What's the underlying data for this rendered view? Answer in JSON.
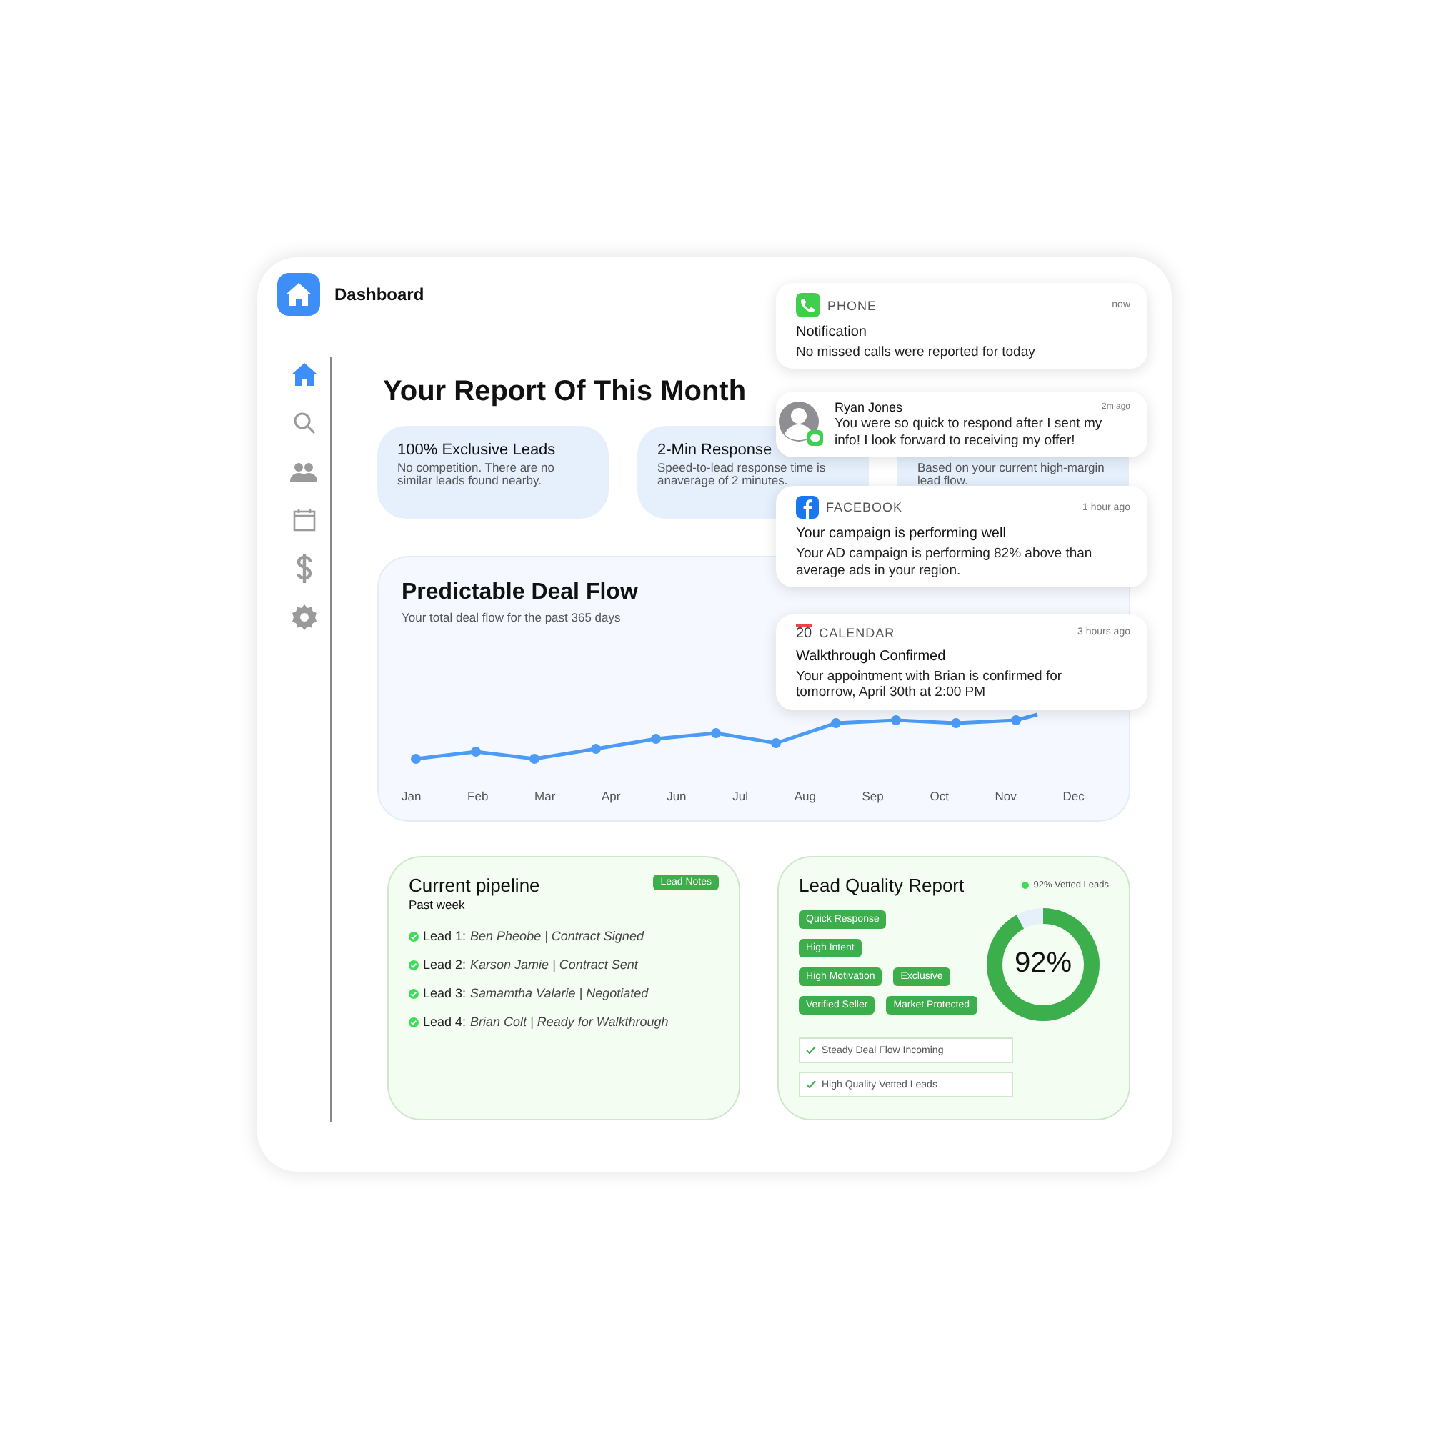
{
  "header": {
    "title": "Dashboard"
  },
  "sidebar": {
    "items": [
      {
        "selected": true
      },
      {
        "selected": false
      },
      {
        "selected": false
      },
      {
        "selected": false
      },
      {
        "selected": false
      },
      {
        "selected": false
      }
    ]
  },
  "report": {
    "title": "Your Report Of This Month",
    "stats": [
      {
        "title": "100% Exclusive Leads",
        "text": "No competition. There are no similar leads found nearby."
      },
      {
        "title": "2-Min Response",
        "text": "Speed-to-lead response time is anaverage of 2 minutes."
      },
      {
        "text": "Based on your current high-margin lead flow."
      }
    ]
  },
  "deal_flow": {
    "title": "Predictable Deal Flow",
    "subtitle": "Your total deal flow for the past 365 days",
    "months": [
      "Jan",
      "Feb",
      "Mar",
      "Apr",
      "Jun",
      "Jul",
      "Aug",
      "Sep",
      "Oct",
      "Nov",
      "Dec"
    ]
  },
  "pipeline": {
    "title": "Current pipeline",
    "subtitle": "Past week",
    "badge": "Lead Notes",
    "leads": [
      {
        "label": "Lead 1:",
        "detail": "Ben Pheobe | Contract Signed"
      },
      {
        "label": "Lead 2:",
        "detail": "Karson Jamie | Contract Sent"
      },
      {
        "label": "Lead 3:",
        "detail": "Samamtha Valarie | Negotiated"
      },
      {
        "label": "Lead 4:",
        "detail": "Brian Colt | Ready for Walkthrough"
      }
    ]
  },
  "quality": {
    "title": "Lead Quality Report",
    "legend": "92% Vetted Leads",
    "value": "92%",
    "level": 0.92,
    "tag_rows": [
      [
        "Quick Response"
      ],
      [
        "High Intent"
      ],
      [
        "High Motivation",
        "Exclusive"
      ],
      [
        "Verified Seller",
        "Market Protected"
      ]
    ],
    "checks": [
      "Steady Deal Flow Incoming",
      "High Quality Vetted Leads"
    ]
  },
  "notifications": [
    {
      "kind": "phone",
      "app": "PHONE",
      "time": "now",
      "title": "Notification",
      "body": "No missed calls were reported for today"
    },
    {
      "kind": "message",
      "sender": "Ryan Jones",
      "time": "2m ago",
      "body": "You were so quick to respond after I sent my info! I look forward to receiving my offer!"
    },
    {
      "kind": "facebook",
      "app": "FACEBOOK",
      "time": "1 hour ago",
      "title": "Your campaign is performing well",
      "body": "Your AD campaign is performing 82% above than average ads in your region."
    },
    {
      "kind": "calendar",
      "app": "CALENDAR",
      "icon_text": "20",
      "time": "3 hours ago",
      "title": "Walkthrough Confirmed",
      "body": "Your appointment with Brian is confirmed for tomorrow, April 30th at 2:00 PM"
    }
  ]
}
